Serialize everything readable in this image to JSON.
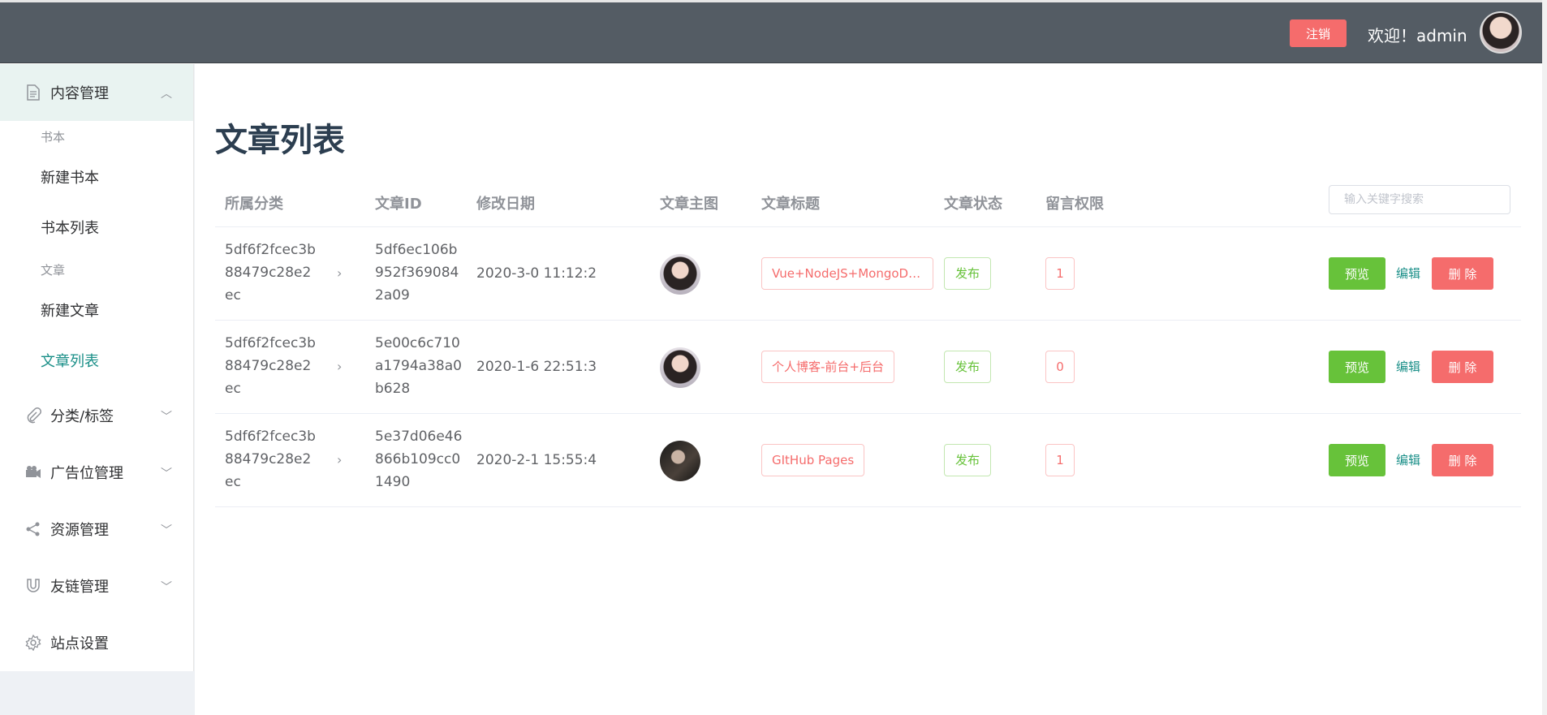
{
  "header": {
    "logout_label": "注销",
    "welcome_text": "欢迎！admin"
  },
  "sidebar": {
    "content_menu": "内容管理",
    "groups": [
      {
        "title": "书本",
        "items": [
          "新建书本",
          "书本列表"
        ]
      },
      {
        "title": "文章",
        "items": [
          "新建文章",
          "文章列表"
        ]
      }
    ],
    "menus": [
      "分类/标签",
      "广告位管理",
      "资源管理",
      "友链管理",
      "站点设置"
    ],
    "active_item": "文章列表"
  },
  "main": {
    "page_title": "文章列表",
    "columns": [
      "所属分类",
      "文章ID",
      "修改日期",
      "文章主图",
      "文章标题",
      "文章状态",
      "留言权限"
    ],
    "search_placeholder": "输入关键字搜索",
    "rows": [
      {
        "category": "5df6f2fcec3b88479c28e2ec",
        "id": "5df6ec106b952f3690842a09",
        "date": "2020-3-0 11:12:2",
        "title": "Vue+NodeJS+MongoDB-…",
        "status": "发布",
        "permission": "1"
      },
      {
        "category": "5df6f2fcec3b88479c28e2ec",
        "id": "5e00c6c710a1794a38a0b628",
        "date": "2020-1-6 22:51:3",
        "title": "个人博客-前台+后台",
        "status": "发布",
        "permission": "0"
      },
      {
        "category": "5df6f2fcec3b88479c28e2ec",
        "id": "5e37d06e46866b109cc01490",
        "date": "2020-2-1 15:55:4",
        "title": "GItHub Pages",
        "status": "发布",
        "permission": "1"
      }
    ],
    "actions": {
      "preview": "预览",
      "edit": "编辑",
      "delete": "删 除"
    }
  },
  "colors": {
    "header_bg": "#545c64",
    "accent": "#1a8f88",
    "danger": "#f56c6c",
    "success": "#67c23a"
  }
}
